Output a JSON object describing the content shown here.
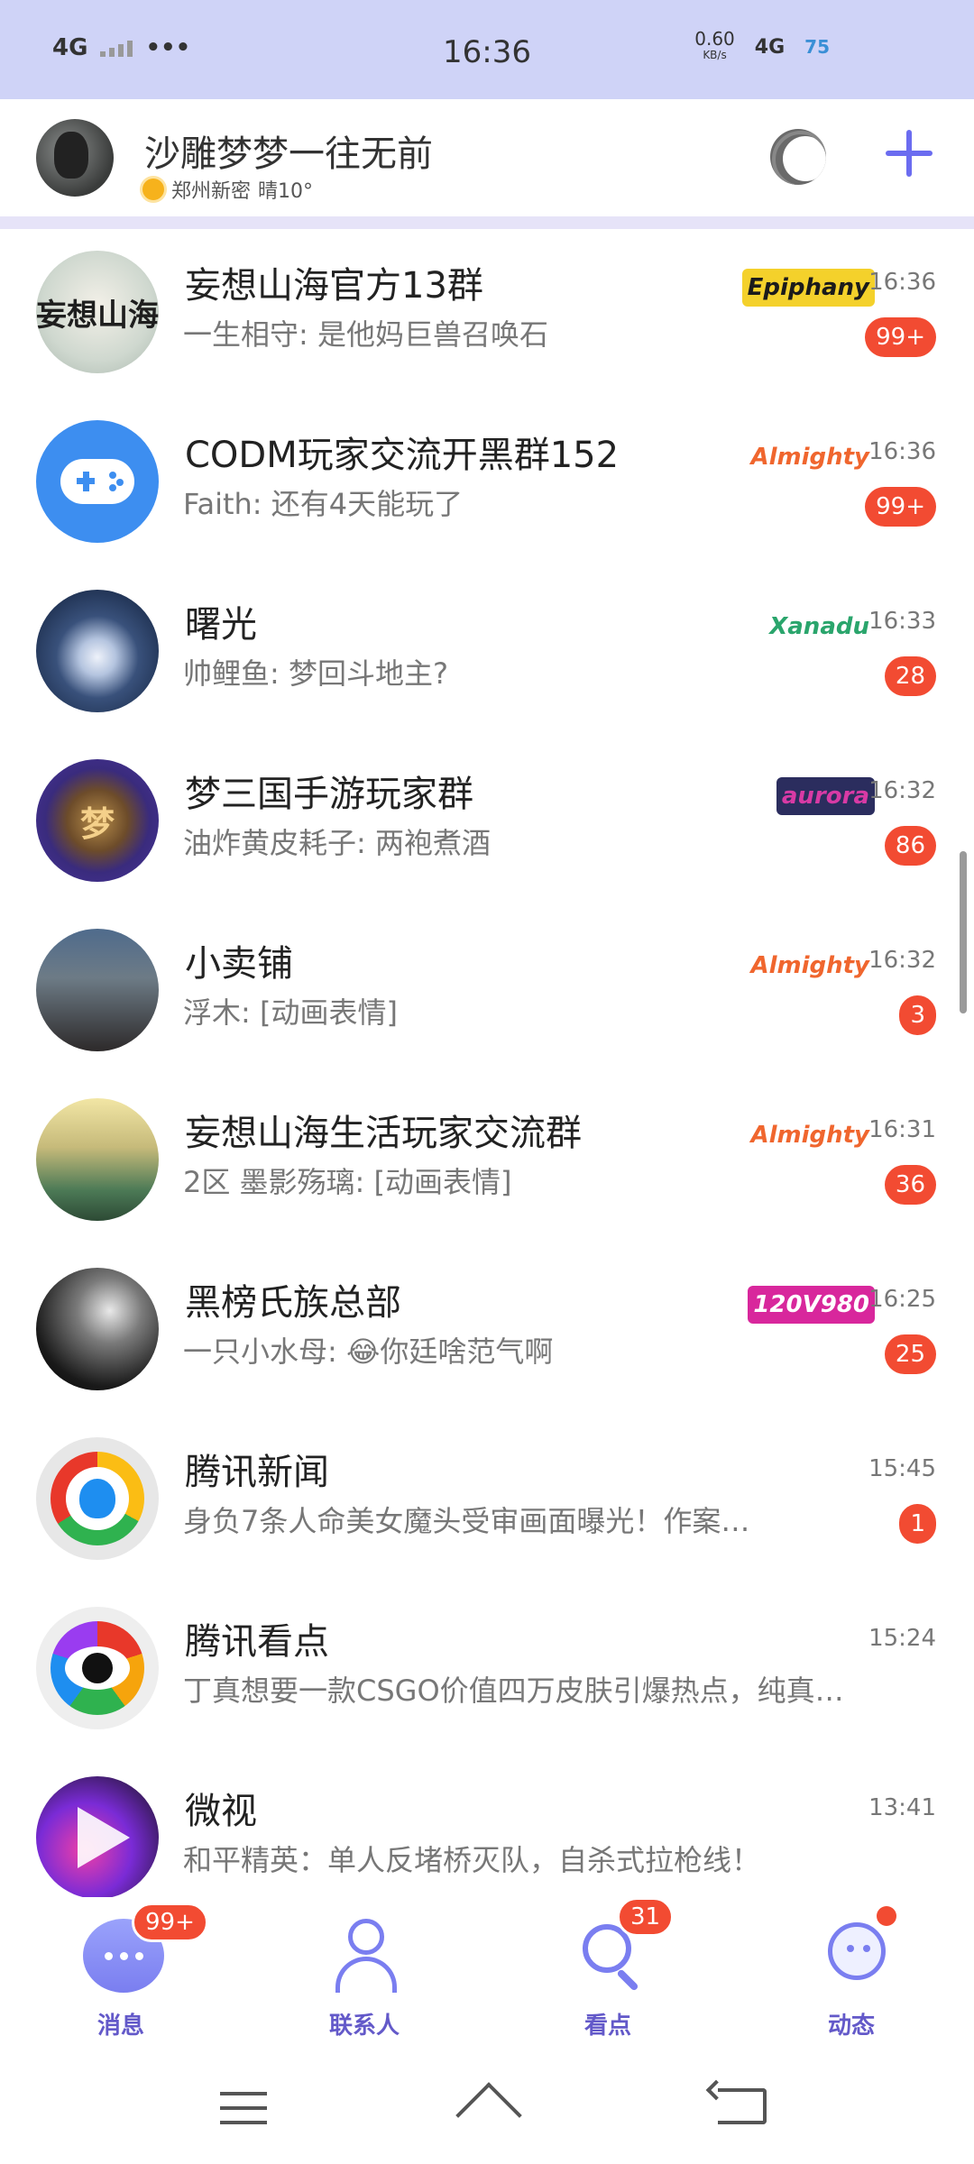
{
  "status_bar": {
    "network": "4G",
    "time": "16:36",
    "speed": "0.60",
    "speed_unit": "KB/s",
    "mobile": "4G",
    "battery": "75"
  },
  "header": {
    "username": "沙雕梦梦一往无前",
    "location": "郑州新密",
    "weather": "晴10°"
  },
  "chats": [
    {
      "title": "妄想山海官方13群",
      "preview": "一生相守: 是他妈巨兽召唤石",
      "time": "16:36",
      "badge": "99+",
      "tag": "Epiphany",
      "tag_color": "#1b1b1b",
      "tag_bg": "#f4d12b",
      "avatar_text": "妄想山海"
    },
    {
      "title": "CODM玩家交流开黑群152",
      "preview": "Faith: 还有4天能玩了",
      "time": "16:36",
      "badge": "99+",
      "tag": "Almighty",
      "tag_color": "#f0662e",
      "tag_bg": "transparent",
      "avatar_text": ""
    },
    {
      "title": "曙光",
      "preview": "帅鲤鱼: 梦回斗地主?",
      "time": "16:33",
      "badge": "28",
      "tag": "Xanadu",
      "tag_color": "#2aa56c",
      "tag_bg": "transparent",
      "avatar_text": ""
    },
    {
      "title": "梦三国手游玩家群",
      "preview": "油炸黄皮耗子: 两袍煮酒",
      "time": "16:32",
      "badge": "86",
      "tag": "aurora",
      "tag_color": "#d83aa5",
      "tag_bg": "#2b2d5e",
      "avatar_text": "梦"
    },
    {
      "title": "小卖铺",
      "preview": "浮木: [动画表情]",
      "time": "16:32",
      "badge": "3",
      "tag": "Almighty",
      "tag_color": "#f0662e",
      "tag_bg": "transparent",
      "avatar_text": ""
    },
    {
      "title": "妄想山海生活玩家交流群",
      "preview": "2区 墨影殇璃: [动画表情]",
      "time": "16:31",
      "badge": "36",
      "tag": "Almighty",
      "tag_color": "#f0662e",
      "tag_bg": "transparent",
      "avatar_text": ""
    },
    {
      "title": "黑榜氏族总部",
      "preview": "一只小水母: 😂你廷啥范气啊",
      "time": "16:25",
      "badge": "25",
      "tag": "120V980",
      "tag_color": "#ffffff",
      "tag_bg": "#d8279c",
      "avatar_text": ""
    },
    {
      "title": "腾讯新闻",
      "preview": "身负7条人命美女魔头受审画面曝光！作案…",
      "time": "15:45",
      "badge": "1",
      "tag": "",
      "tag_color": "",
      "tag_bg": "",
      "avatar_text": ""
    },
    {
      "title": "腾讯看点",
      "preview": "丁真想要一款CSGO价值四万皮肤引爆热点，纯真…",
      "time": "15:24",
      "badge": "",
      "tag": "",
      "tag_color": "",
      "tag_bg": "",
      "avatar_text": ""
    },
    {
      "title": "微视",
      "preview": "和平精英：单人反堵桥灭队，自杀式拉枪线！",
      "time": "13:41",
      "badge": "",
      "tag": "",
      "tag_color": "",
      "tag_bg": "",
      "avatar_text": ""
    }
  ],
  "tabs": {
    "messages": {
      "label": "消息",
      "badge": "99+"
    },
    "contacts": {
      "label": "联系人"
    },
    "discover": {
      "label": "看点",
      "badge": "31"
    },
    "moments": {
      "label": "动态"
    }
  },
  "colors": {
    "accent": "#6b6cf0",
    "badge": "#f24b32",
    "status_bar_bg": "#cfd3f7"
  }
}
